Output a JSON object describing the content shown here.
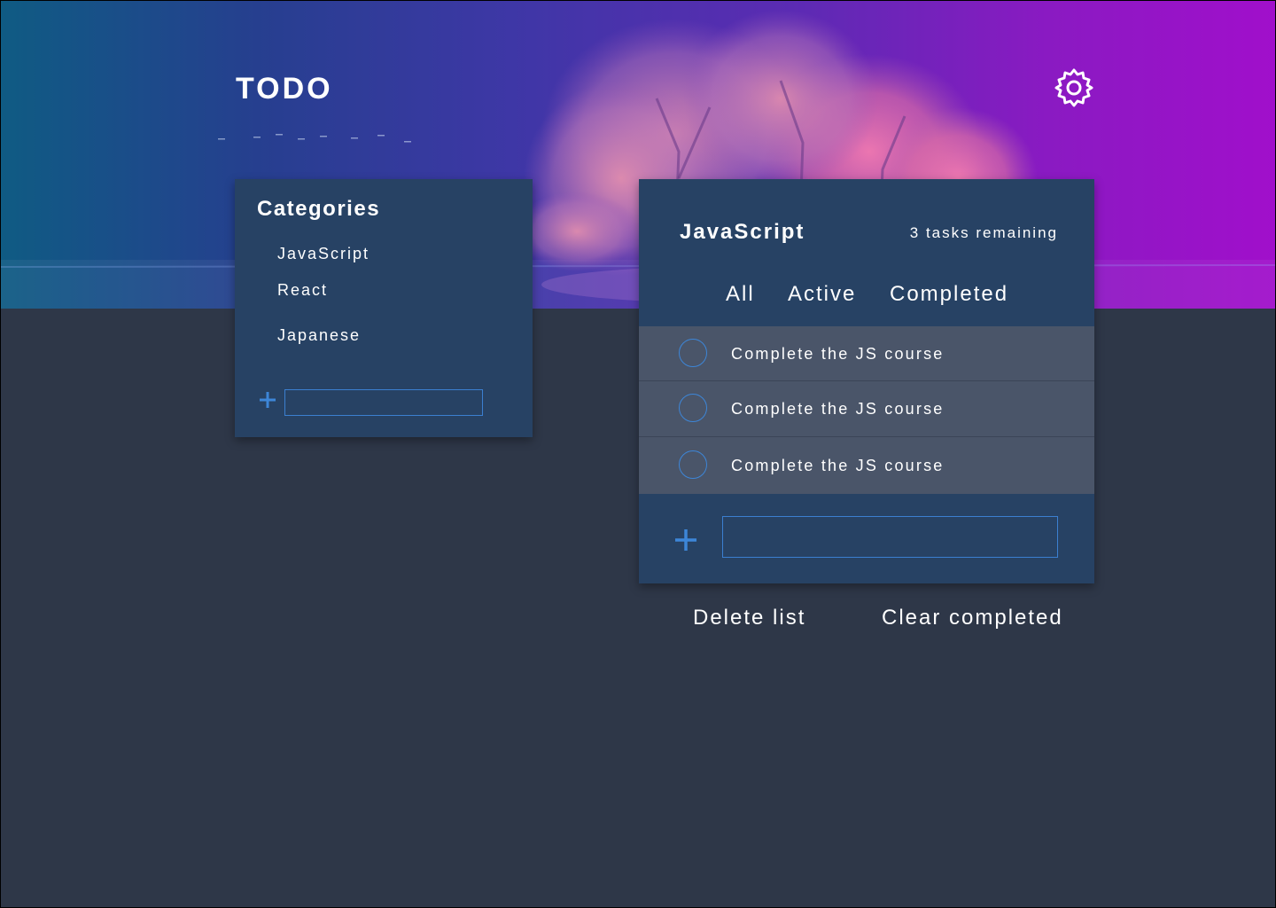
{
  "app": {
    "title": "TODO",
    "settings_icon": "gear-icon"
  },
  "colors": {
    "page_background": "#2e3748",
    "panel_background": "#274264",
    "task_row_background": "#4a5569",
    "accent": "#3b86d8",
    "hero_gradient_start": "#0f5b83",
    "hero_gradient_end": "#a10fcb"
  },
  "categories": {
    "title": "Categories",
    "items": [
      {
        "label": "JavaScript"
      },
      {
        "label": "React"
      },
      {
        "label": "Japanese"
      }
    ],
    "add_icon": "plus-icon",
    "new_category_value": "",
    "new_category_placeholder": ""
  },
  "list": {
    "title": "JavaScript",
    "remaining": "3 tasks remaining",
    "filters": [
      "All",
      "Active",
      "Completed"
    ],
    "tasks": [
      {
        "text": "Complete the JS course",
        "completed": false
      },
      {
        "text": "Complete the JS course",
        "completed": false
      },
      {
        "text": "Complete the JS course",
        "completed": false
      }
    ],
    "add_icon": "plus-icon",
    "new_task_value": "",
    "new_task_placeholder": ""
  },
  "actions": {
    "delete_list": "Delete list",
    "clear_completed": "Clear completed"
  }
}
